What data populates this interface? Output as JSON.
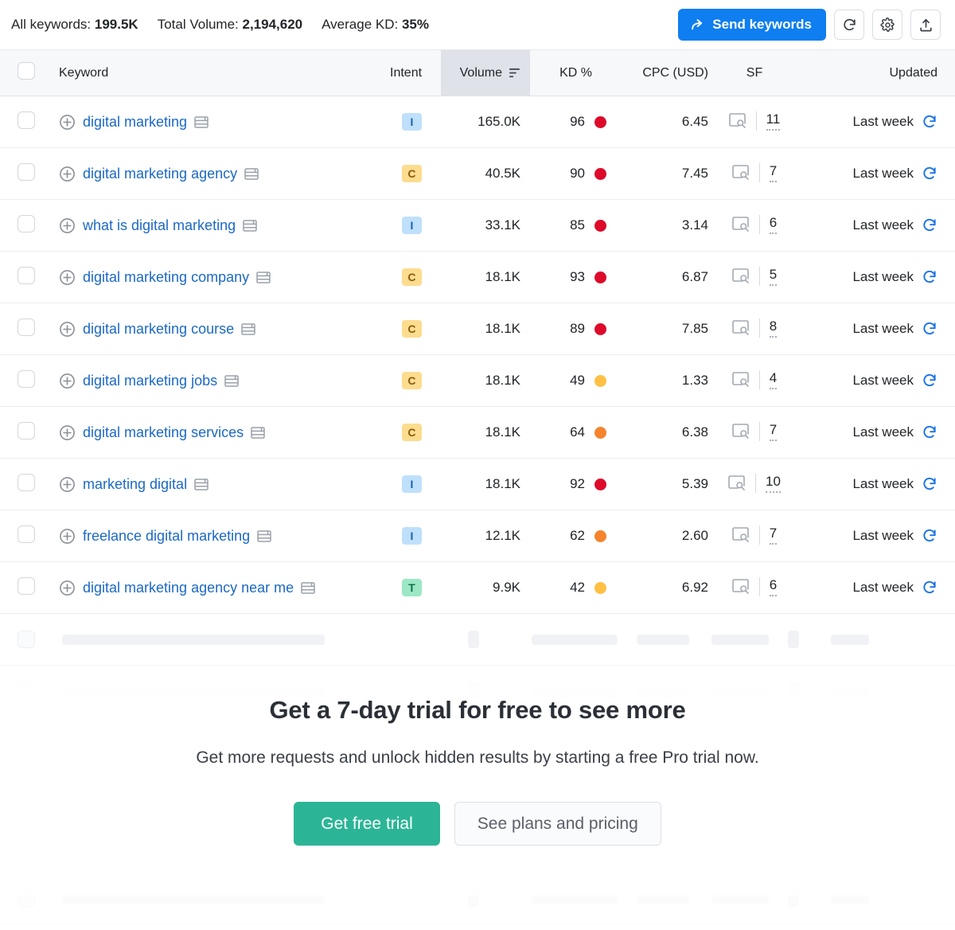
{
  "summary": {
    "all_keywords_label": "All keywords:",
    "all_keywords_value": "199.5K",
    "total_volume_label": "Total Volume:",
    "total_volume_value": "2,194,620",
    "average_kd_label": "Average KD:",
    "average_kd_value": "35%"
  },
  "toolbar": {
    "send_keywords_label": "Send keywords",
    "send_icon": "share-arrow-icon",
    "refresh_icon": "refresh-icon",
    "settings_icon": "gear-icon",
    "export_icon": "export-upload-icon",
    "send_button_color": "#0e7ef0"
  },
  "table": {
    "columns": [
      {
        "key": "select",
        "label": ""
      },
      {
        "key": "keyword",
        "label": "Keyword"
      },
      {
        "key": "intent",
        "label": "Intent"
      },
      {
        "key": "volume",
        "label": "Volume",
        "sorted": true,
        "sort_icon": "sort-descending-icon"
      },
      {
        "key": "kd",
        "label": "KD %"
      },
      {
        "key": "cpc",
        "label": "CPC (USD)"
      },
      {
        "key": "sf",
        "label": "SF"
      },
      {
        "key": "updated",
        "label": "Updated"
      }
    ],
    "rows": [
      {
        "keyword": "digital marketing",
        "intent": "I",
        "volume": "165.0K",
        "kd": "96",
        "kd_color": "#dd0a2a",
        "cpc": "6.45",
        "sf": "11",
        "updated": "Last week"
      },
      {
        "keyword": "digital marketing agency",
        "intent": "C",
        "volume": "40.5K",
        "kd": "90",
        "kd_color": "#dd0a2a",
        "cpc": "7.45",
        "sf": "7",
        "updated": "Last week"
      },
      {
        "keyword": "what is digital marketing",
        "intent": "I",
        "volume": "33.1K",
        "kd": "85",
        "kd_color": "#dd0a2a",
        "cpc": "3.14",
        "sf": "6",
        "updated": "Last week"
      },
      {
        "keyword": "digital marketing company",
        "intent": "C",
        "volume": "18.1K",
        "kd": "93",
        "kd_color": "#dd0a2a",
        "cpc": "6.87",
        "sf": "5",
        "updated": "Last week"
      },
      {
        "keyword": "digital marketing course",
        "intent": "C",
        "volume": "18.1K",
        "kd": "89",
        "kd_color": "#dd0a2a",
        "cpc": "7.85",
        "sf": "8",
        "updated": "Last week"
      },
      {
        "keyword": "digital marketing jobs",
        "intent": "C",
        "volume": "18.1K",
        "kd": "49",
        "kd_color": "#ffc043",
        "cpc": "1.33",
        "sf": "4",
        "updated": "Last week"
      },
      {
        "keyword": "digital marketing services",
        "intent": "C",
        "volume": "18.1K",
        "kd": "64",
        "kd_color": "#f5842d",
        "cpc": "6.38",
        "sf": "7",
        "updated": "Last week"
      },
      {
        "keyword": "marketing digital",
        "intent": "I",
        "volume": "18.1K",
        "kd": "92",
        "kd_color": "#dd0a2a",
        "cpc": "5.39",
        "sf": "10",
        "updated": "Last week"
      },
      {
        "keyword": "freelance digital marketing",
        "intent": "I",
        "volume": "12.1K",
        "kd": "62",
        "kd_color": "#f5842d",
        "cpc": "2.60",
        "sf": "7",
        "updated": "Last week"
      },
      {
        "keyword": "digital marketing agency near me",
        "intent": "T",
        "volume": "9.9K",
        "kd": "42",
        "kd_color": "#ffc043",
        "cpc": "6.92",
        "sf": "6",
        "updated": "Last week"
      }
    ],
    "row_icons": {
      "add_keyword_icon": "plus-circle-icon",
      "serp_preview_icon": "serp-window-icon",
      "sf_feature_icon": "serp-search-icon",
      "updated_refresh_icon": "refresh-icon"
    }
  },
  "cta": {
    "heading": "Get a 7-day trial for free to see more",
    "subtext": "Get more requests and unlock hidden results by starting a free Pro trial now.",
    "primary_label": "Get free trial",
    "secondary_label": "See plans and pricing",
    "primary_color": "#2bb596"
  }
}
